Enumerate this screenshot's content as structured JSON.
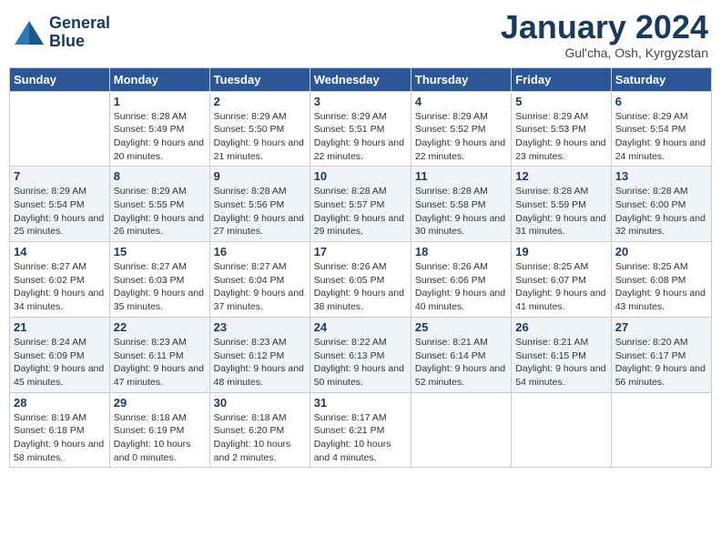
{
  "logo": {
    "line1": "General",
    "line2": "Blue"
  },
  "title": "January 2024",
  "subtitle": "Gul'cha, Osh, Kyrgyzstan",
  "days_of_week": [
    "Sunday",
    "Monday",
    "Tuesday",
    "Wednesday",
    "Thursday",
    "Friday",
    "Saturday"
  ],
  "weeks": [
    [
      {
        "day": "",
        "sunrise": "",
        "sunset": "",
        "daylight": ""
      },
      {
        "day": "1",
        "sunrise": "Sunrise: 8:28 AM",
        "sunset": "Sunset: 5:49 PM",
        "daylight": "Daylight: 9 hours and 20 minutes."
      },
      {
        "day": "2",
        "sunrise": "Sunrise: 8:29 AM",
        "sunset": "Sunset: 5:50 PM",
        "daylight": "Daylight: 9 hours and 21 minutes."
      },
      {
        "day": "3",
        "sunrise": "Sunrise: 8:29 AM",
        "sunset": "Sunset: 5:51 PM",
        "daylight": "Daylight: 9 hours and 22 minutes."
      },
      {
        "day": "4",
        "sunrise": "Sunrise: 8:29 AM",
        "sunset": "Sunset: 5:52 PM",
        "daylight": "Daylight: 9 hours and 22 minutes."
      },
      {
        "day": "5",
        "sunrise": "Sunrise: 8:29 AM",
        "sunset": "Sunset: 5:53 PM",
        "daylight": "Daylight: 9 hours and 23 minutes."
      },
      {
        "day": "6",
        "sunrise": "Sunrise: 8:29 AM",
        "sunset": "Sunset: 5:54 PM",
        "daylight": "Daylight: 9 hours and 24 minutes."
      }
    ],
    [
      {
        "day": "7",
        "sunrise": "",
        "sunset": "",
        "daylight": ""
      },
      {
        "day": "8",
        "sunrise": "Sunrise: 8:29 AM",
        "sunset": "Sunset: 5:55 PM",
        "daylight": "Daylight: 9 hours and 26 minutes."
      },
      {
        "day": "9",
        "sunrise": "Sunrise: 8:28 AM",
        "sunset": "Sunset: 5:56 PM",
        "daylight": "Daylight: 9 hours and 27 minutes."
      },
      {
        "day": "10",
        "sunrise": "Sunrise: 8:28 AM",
        "sunset": "Sunset: 5:57 PM",
        "daylight": "Daylight: 9 hours and 29 minutes."
      },
      {
        "day": "11",
        "sunrise": "Sunrise: 8:28 AM",
        "sunset": "Sunset: 5:58 PM",
        "daylight": "Daylight: 9 hours and 30 minutes."
      },
      {
        "day": "12",
        "sunrise": "Sunrise: 8:28 AM",
        "sunset": "Sunset: 5:59 PM",
        "daylight": "Daylight: 9 hours and 31 minutes."
      },
      {
        "day": "13",
        "sunrise": "Sunrise: 8:28 AM",
        "sunset": "Sunset: 6:00 PM",
        "daylight": "Daylight: 9 hours and 32 minutes."
      }
    ],
    [
      {
        "day": "14",
        "sunrise": "",
        "sunset": "",
        "daylight": ""
      },
      {
        "day": "15",
        "sunrise": "Sunrise: 8:27 AM",
        "sunset": "Sunset: 6:03 PM",
        "daylight": "Daylight: 9 hours and 35 minutes."
      },
      {
        "day": "16",
        "sunrise": "Sunrise: 8:27 AM",
        "sunset": "Sunset: 6:04 PM",
        "daylight": "Daylight: 9 hours and 37 minutes."
      },
      {
        "day": "17",
        "sunrise": "Sunrise: 8:26 AM",
        "sunset": "Sunset: 6:05 PM",
        "daylight": "Daylight: 9 hours and 38 minutes."
      },
      {
        "day": "18",
        "sunrise": "Sunrise: 8:26 AM",
        "sunset": "Sunset: 6:06 PM",
        "daylight": "Daylight: 9 hours and 40 minutes."
      },
      {
        "day": "19",
        "sunrise": "Sunrise: 8:25 AM",
        "sunset": "Sunset: 6:07 PM",
        "daylight": "Daylight: 9 hours and 41 minutes."
      },
      {
        "day": "20",
        "sunrise": "Sunrise: 8:25 AM",
        "sunset": "Sunset: 6:08 PM",
        "daylight": "Daylight: 9 hours and 43 minutes."
      }
    ],
    [
      {
        "day": "21",
        "sunrise": "",
        "sunset": "",
        "daylight": ""
      },
      {
        "day": "22",
        "sunrise": "Sunrise: 8:23 AM",
        "sunset": "Sunset: 6:11 PM",
        "daylight": "Daylight: 9 hours and 47 minutes."
      },
      {
        "day": "23",
        "sunrise": "Sunrise: 8:23 AM",
        "sunset": "Sunset: 6:12 PM",
        "daylight": "Daylight: 9 hours and 48 minutes."
      },
      {
        "day": "24",
        "sunrise": "Sunrise: 8:22 AM",
        "sunset": "Sunset: 6:13 PM",
        "daylight": "Daylight: 9 hours and 50 minutes."
      },
      {
        "day": "25",
        "sunrise": "Sunrise: 8:21 AM",
        "sunset": "Sunset: 6:14 PM",
        "daylight": "Daylight: 9 hours and 52 minutes."
      },
      {
        "day": "26",
        "sunrise": "Sunrise: 8:21 AM",
        "sunset": "Sunset: 6:15 PM",
        "daylight": "Daylight: 9 hours and 54 minutes."
      },
      {
        "day": "27",
        "sunrise": "Sunrise: 8:20 AM",
        "sunset": "Sunset: 6:17 PM",
        "daylight": "Daylight: 9 hours and 56 minutes."
      }
    ],
    [
      {
        "day": "28",
        "sunrise": "",
        "sunset": "",
        "daylight": ""
      },
      {
        "day": "29",
        "sunrise": "Sunrise: 8:18 AM",
        "sunset": "Sunset: 6:19 PM",
        "daylight": "Daylight: 10 hours and 0 minutes."
      },
      {
        "day": "30",
        "sunrise": "Sunrise: 8:18 AM",
        "sunset": "Sunset: 6:20 PM",
        "daylight": "Daylight: 10 hours and 2 minutes."
      },
      {
        "day": "31",
        "sunrise": "Sunrise: 8:17 AM",
        "sunset": "Sunset: 6:21 PM",
        "daylight": "Daylight: 10 hours and 4 minutes."
      },
      {
        "day": "",
        "sunrise": "",
        "sunset": "",
        "daylight": ""
      },
      {
        "day": "",
        "sunrise": "",
        "sunset": "",
        "daylight": ""
      },
      {
        "day": "",
        "sunrise": "",
        "sunset": "",
        "daylight": ""
      }
    ]
  ],
  "week2_sun": {
    "day": "7",
    "sunrise": "Sunrise: 8:29 AM",
    "sunset": "Sunset: 5:54 PM",
    "daylight": "Daylight: 9 hours and 25 minutes."
  },
  "week3_sun": {
    "day": "14",
    "sunrise": "Sunrise: 8:27 AM",
    "sunset": "Sunset: 6:02 PM",
    "daylight": "Daylight: 9 hours and 34 minutes."
  },
  "week4_sun": {
    "day": "21",
    "sunrise": "Sunrise: 8:24 AM",
    "sunset": "Sunset: 6:09 PM",
    "daylight": "Daylight: 9 hours and 45 minutes."
  },
  "week5_sun": {
    "day": "28",
    "sunrise": "Sunrise: 8:19 AM",
    "sunset": "Sunset: 6:18 PM",
    "daylight": "Daylight: 9 hours and 58 minutes."
  }
}
